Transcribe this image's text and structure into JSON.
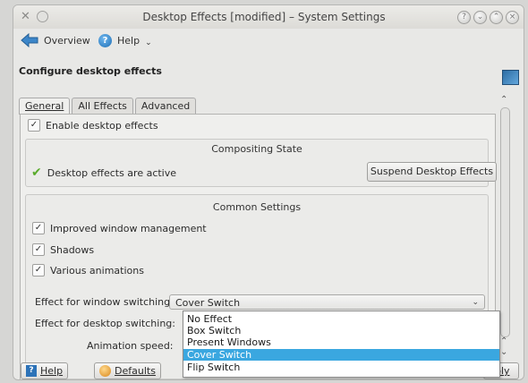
{
  "window": {
    "title": "Desktop Effects [modified] – System Settings"
  },
  "toolbar": {
    "overview_label": "Overview",
    "help_label": "Help"
  },
  "page": {
    "heading": "Configure desktop effects"
  },
  "tabs": [
    {
      "label": "General"
    },
    {
      "label": "All Effects"
    },
    {
      "label": "Advanced"
    }
  ],
  "general": {
    "enable_effects_label": "Enable desktop effects",
    "compositing": {
      "title": "Compositing State",
      "status_text": "Desktop effects are active",
      "suspend_button": "Suspend Desktop Effects"
    },
    "common": {
      "title": "Common Settings",
      "options": [
        {
          "label": "Improved window management",
          "checked": true
        },
        {
          "label": "Shadows",
          "checked": true
        },
        {
          "label": "Various animations",
          "checked": true
        }
      ],
      "window_switching_label": "Effect for window switching:",
      "window_switching_value": "Cover Switch",
      "desktop_switching_label": "Effect for desktop switching:",
      "animation_speed_label": "Animation speed:"
    }
  },
  "dropdown": {
    "options": [
      "No Effect",
      "Box Switch",
      "Present Windows",
      "Cover Switch",
      "Flip Switch"
    ],
    "selected_index": 3
  },
  "footer": {
    "help_button": "Help",
    "defaults_button": "Defaults",
    "apply_button_partial": "pply"
  },
  "colors": {
    "selection": "#3aa7e0",
    "check_green": "#5aab2c"
  }
}
